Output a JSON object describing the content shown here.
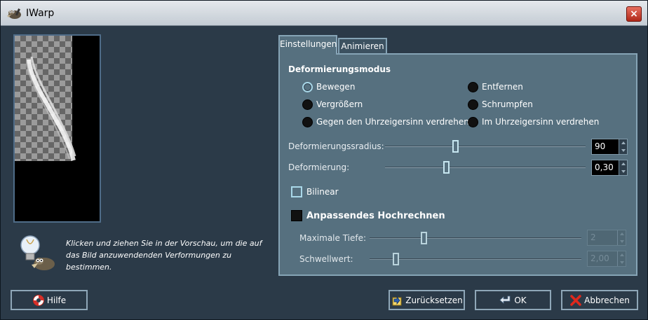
{
  "window": {
    "title": "IWarp",
    "close_label": "×"
  },
  "hint": {
    "lines": [
      "Klicken und ziehen Sie in der Vorschau, um die auf",
      "das Bild anzuwendenden Verformungen zu",
      "bestimmen."
    ]
  },
  "tabs": [
    {
      "label": "Einstellungen",
      "active": true
    },
    {
      "label": "Animieren",
      "active": false
    }
  ],
  "settings": {
    "mode_title": "Deformierungsmodus",
    "modes": [
      {
        "label": "Bewegen",
        "selected": true
      },
      {
        "label": "Entfernen",
        "selected": false
      },
      {
        "label": "Vergrößern",
        "selected": false
      },
      {
        "label": "Schrumpfen",
        "selected": false
      },
      {
        "label": "Gegen den Uhrzeigersinn verdrehen",
        "selected": false
      },
      {
        "label": "Im Uhrzeigersinn verdrehen",
        "selected": false
      }
    ],
    "radius": {
      "label": "Deformierungssradius:",
      "value": "90"
    },
    "amount": {
      "label": "Deformierung:",
      "value": "0,30"
    },
    "bilinear": {
      "label": "Bilinear",
      "checked": false
    },
    "supersample": {
      "label": "Anpassendes Hochrechnen",
      "checked": false
    },
    "max_depth": {
      "label": "Maximale Tiefe:",
      "value": "2"
    },
    "threshold": {
      "label": "Schwellwert:",
      "value": "2,00"
    }
  },
  "buttons": {
    "help": "Hilfe",
    "reset": "Zurücksetzen",
    "ok": "OK",
    "cancel": "Abbrechen"
  },
  "colors": {
    "background": "#2b3a48",
    "panel": "#56707f",
    "border": "#86a4b6",
    "accent": "#a9d8e9"
  }
}
